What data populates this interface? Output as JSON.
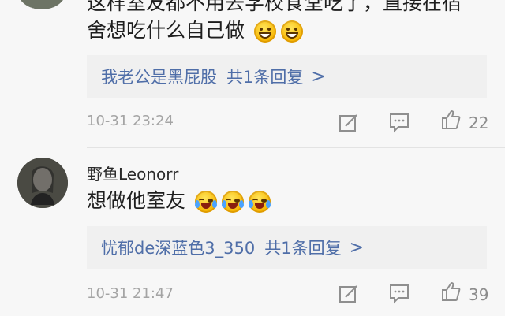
{
  "comment_top": {
    "line1": "这样室友都不用去学校食堂吃了，直接在宿",
    "line2": "舍想吃什么自己做",
    "emojis": [
      "grin-icon",
      "grin-icon"
    ],
    "reply": {
      "name": "我老公是黑屁股",
      "count": "共1条回复",
      "chevron": ">"
    },
    "timestamp": "10-31 23:24",
    "likes": "22"
  },
  "comment_main": {
    "username": "野鱼Leonorr",
    "text": "想做他室友",
    "emojis": [
      "laugh-cry-icon",
      "laugh-cry-icon",
      "laugh-cry-icon"
    ],
    "reply": {
      "name": "忧郁de深蓝色3_350",
      "count": "共1条回复",
      "chevron": ">"
    },
    "timestamp": "10-31 21:47",
    "likes": "39"
  },
  "colors": {
    "background": "#f7f7f7",
    "reply_box": "#f0f0f0",
    "link": "#4f6ea8",
    "meta_text": "#a4a4a4"
  },
  "icons": [
    "edit-icon",
    "comment-icon",
    "thumbs-up-icon"
  ]
}
